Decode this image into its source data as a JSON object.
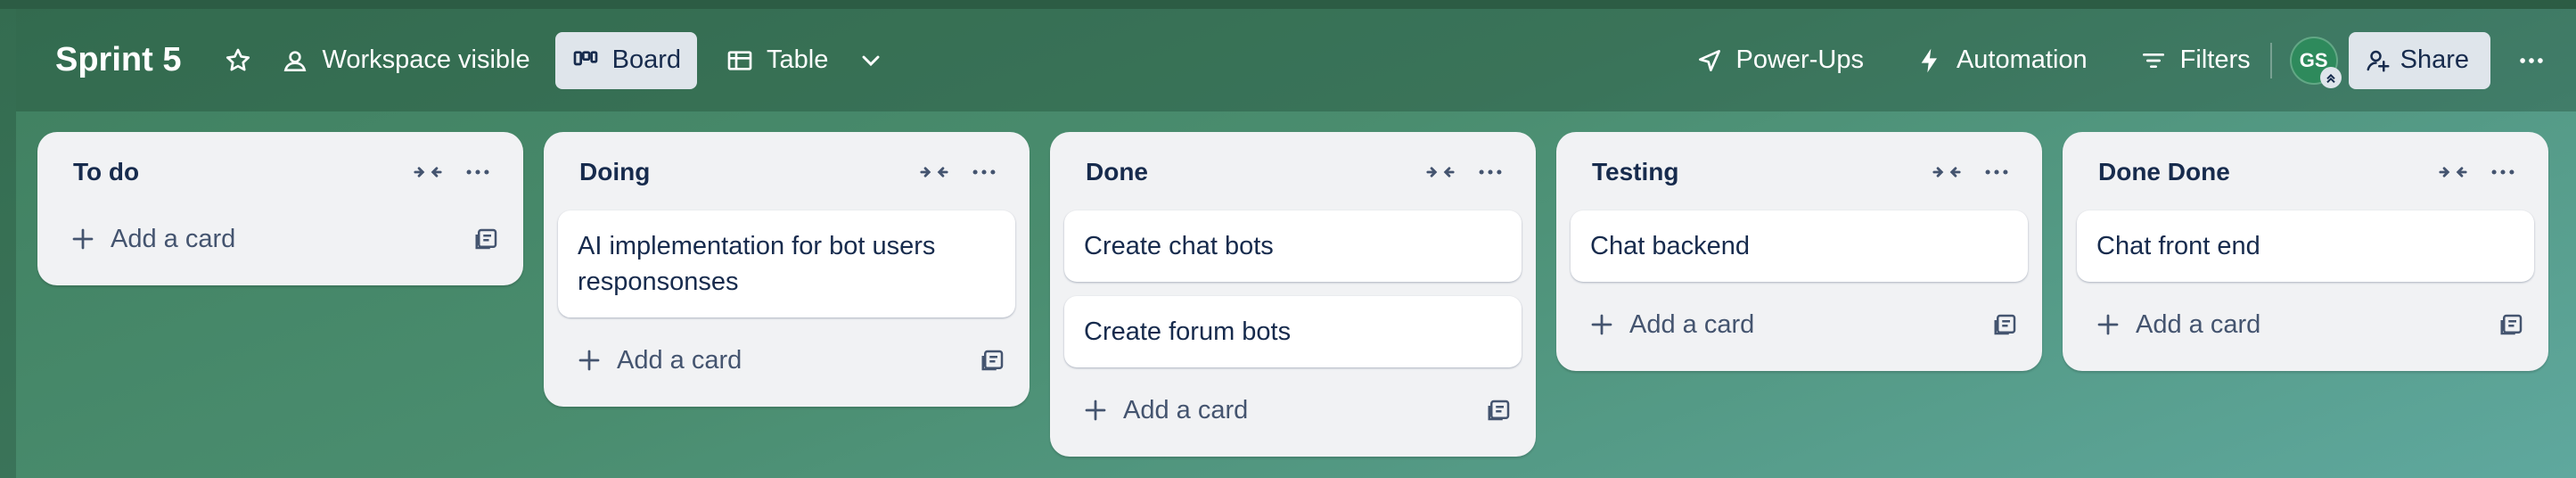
{
  "header": {
    "board_title": "Sprint 5",
    "visibility_label": "Workspace visible",
    "views": [
      {
        "label": "Board",
        "active": true
      },
      {
        "label": "Table",
        "active": false
      }
    ],
    "powerups_label": "Power-Ups",
    "automation_label": "Automation",
    "filters_label": "Filters",
    "avatar_initials": "GS",
    "share_label": "Share"
  },
  "lists": [
    {
      "title": "To do",
      "cards": [],
      "add_label": "Add a card"
    },
    {
      "title": "Doing",
      "cards": [
        "AI implementation for bot users responsonses"
      ],
      "add_label": "Add a card"
    },
    {
      "title": "Done",
      "cards": [
        "Create chat bots",
        "Create forum bots"
      ],
      "add_label": "Add a card"
    },
    {
      "title": "Testing",
      "cards": [
        "Chat backend"
      ],
      "add_label": "Add a card"
    },
    {
      "title": "Done Done",
      "cards": [
        "Chat front end"
      ],
      "add_label": "Add a card"
    }
  ],
  "icons": {
    "star": "star-icon",
    "visibility": "people-icon",
    "board": "board-icon",
    "table": "table-icon",
    "views_dropdown": "chevron-down-icon",
    "powerups": "rocket-icon",
    "automation": "lightning-icon",
    "filters": "filter-icon",
    "share": "add-person-icon",
    "more": "ellipsis-icon",
    "collapse": "collapse-icon",
    "add": "plus-icon",
    "template": "card-template-icon"
  },
  "colors": {
    "board_bg_start": "#3f7f5f",
    "board_bg_end": "#5fa89e",
    "list_bg": "#f1f2f4",
    "avatar_bg": "#2e8a5c"
  }
}
